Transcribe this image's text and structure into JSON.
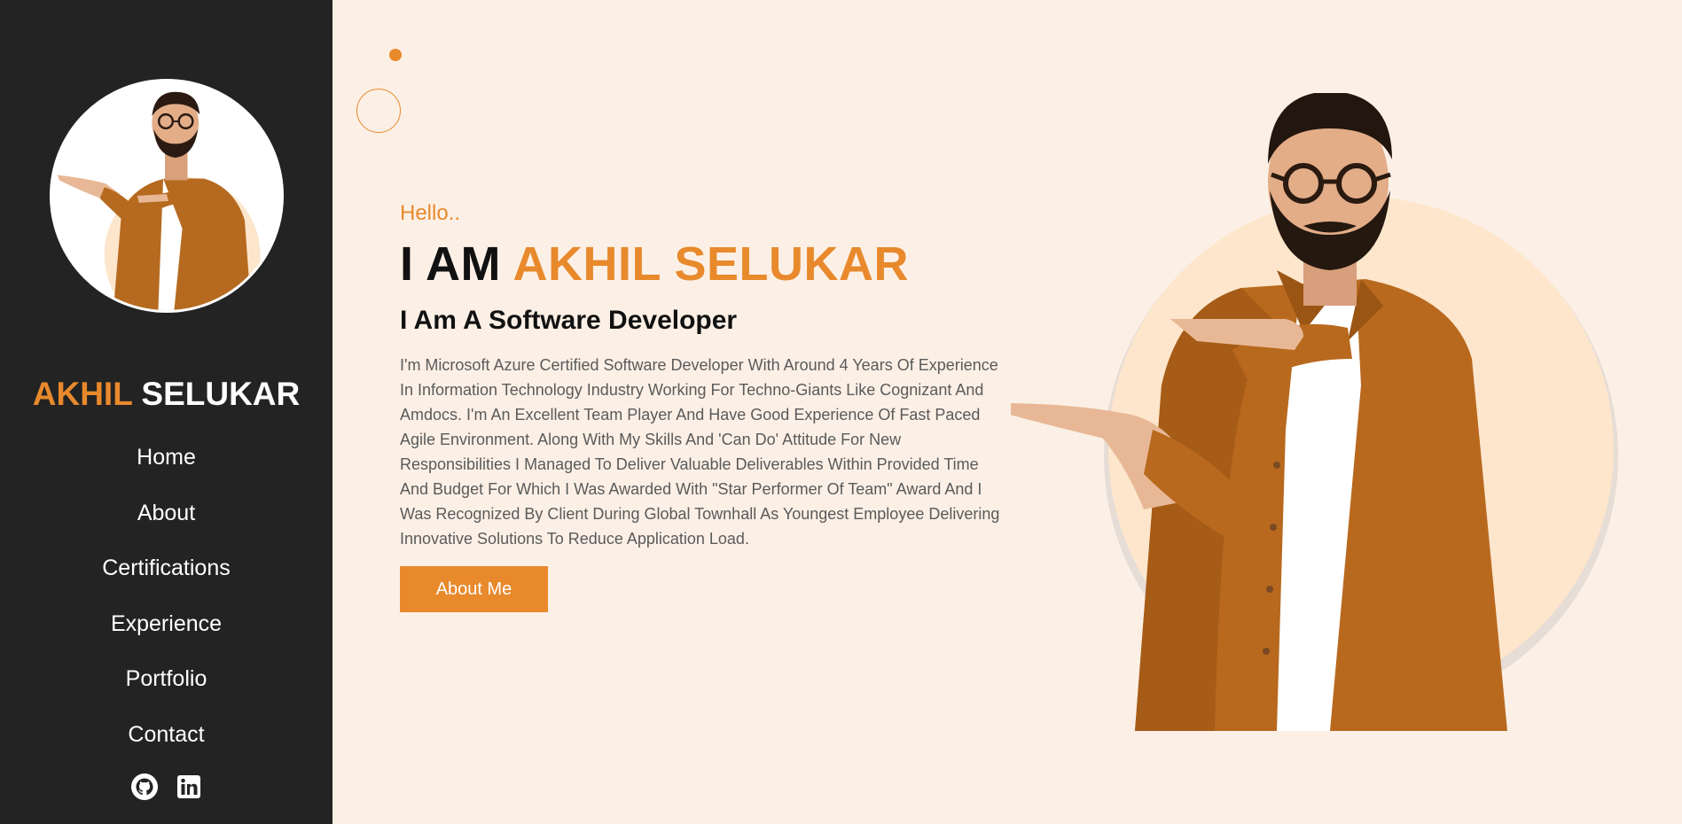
{
  "sidebar": {
    "brand": {
      "first": "AKHIL",
      "last": "SELUKAR"
    },
    "nav": [
      {
        "label": "Home"
      },
      {
        "label": "About"
      },
      {
        "label": "Certifications"
      },
      {
        "label": "Experience"
      },
      {
        "label": "Portfolio"
      },
      {
        "label": "Contact"
      }
    ],
    "socials": [
      {
        "icon": "github-icon"
      },
      {
        "icon": "linkedin-icon"
      }
    ]
  },
  "hero": {
    "greeting": "Hello..",
    "headline_prefix": "I AM",
    "headline_name": "AKHIL SELUKAR",
    "role": "I Am A Software Developer",
    "bio": "I'm Microsoft Azure Certified Software Developer With Around 4 Years Of Experience In Information Technology Industry Working For Techno-Giants Like Cognizant And Amdocs. I'm An Excellent Team Player And Have Good Experience Of Fast Paced Agile Environment. Along With My Skills And 'Can Do' Attitude For New Responsibilities I Managed To Deliver Valuable Deliverables Within Provided Time And Budget For Which I Was Awarded With \"Star Performer Of Team\" Award And I Was Recognized By Client During Global Townhall As Youngest Employee Delivering Innovative Solutions To Reduce Application Load.",
    "cta_label": "About Me"
  },
  "colors": {
    "accent": "#e8892c",
    "sidebar_bg": "#232323",
    "page_bg": "#fcf0e6"
  }
}
